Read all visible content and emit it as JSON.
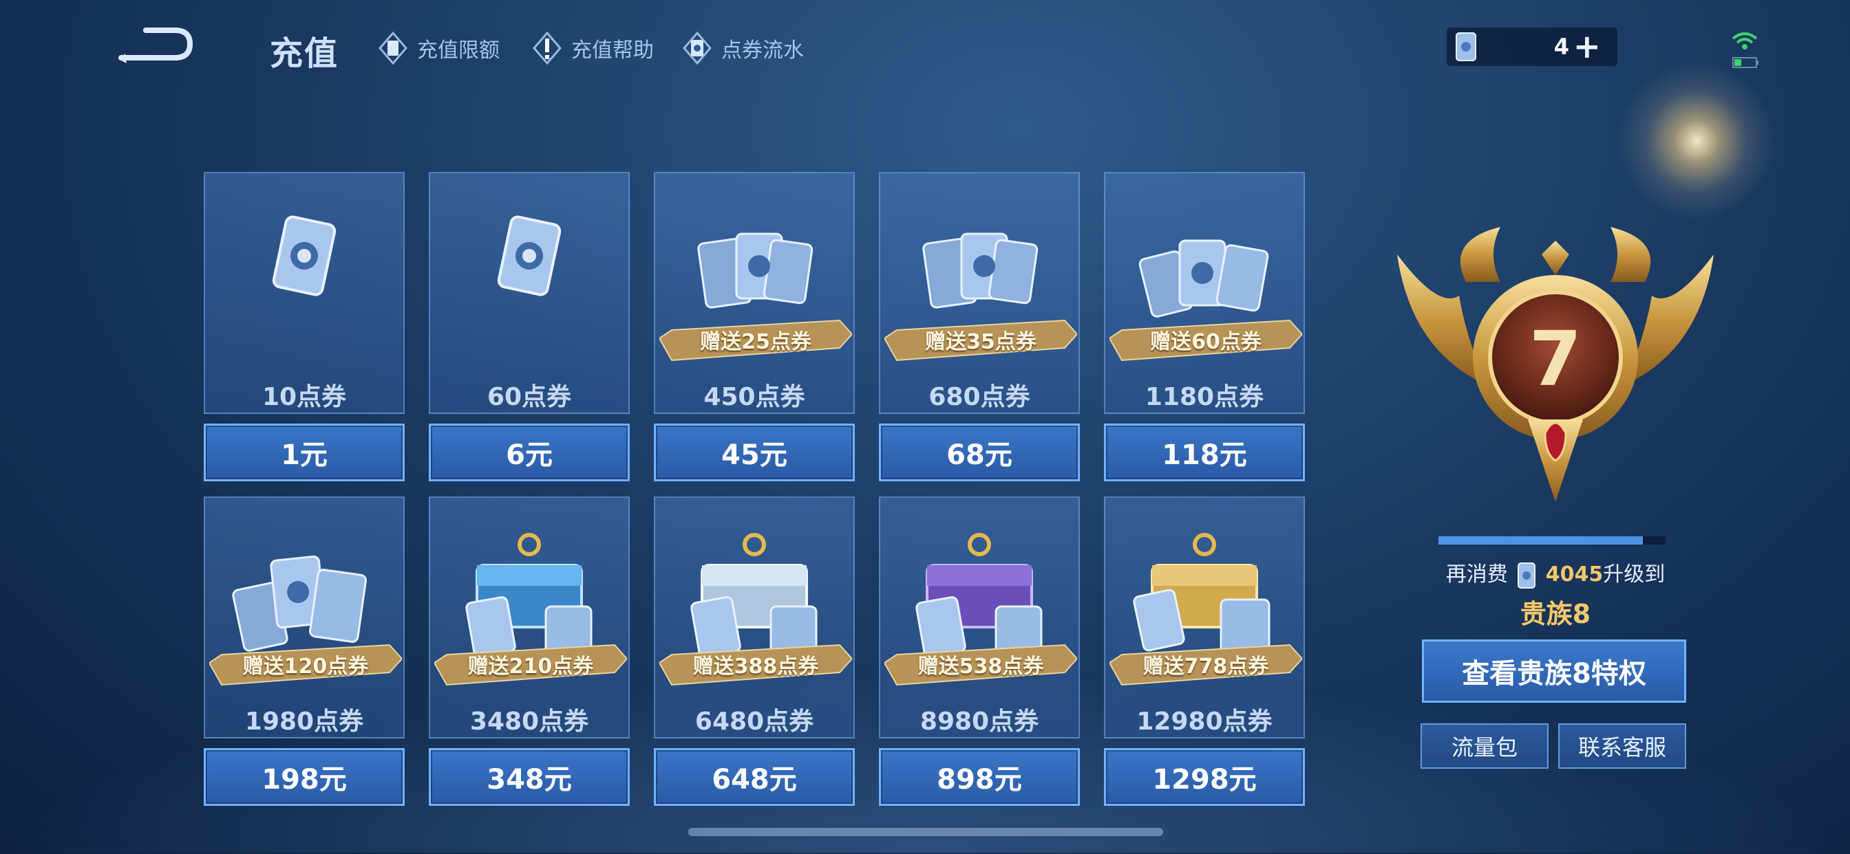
{
  "header": {
    "title": "充值",
    "links": [
      {
        "label": "充值限额",
        "icon": "card-icon"
      },
      {
        "label": "充值帮助",
        "icon": "exclamation-icon"
      },
      {
        "label": "点券流水",
        "icon": "voucher-icon"
      }
    ],
    "currency_amount": "4",
    "plus_label": "+"
  },
  "packages": [
    {
      "qty": "10点券",
      "price": "1元",
      "bonus": "",
      "art": "single-voucher"
    },
    {
      "qty": "60点券",
      "price": "6元",
      "bonus": "",
      "art": "single-voucher"
    },
    {
      "qty": "450点券",
      "price": "45元",
      "bonus": "赠送25点券",
      "art": "voucher-stack-small"
    },
    {
      "qty": "680点券",
      "price": "68元",
      "bonus": "赠送35点券",
      "art": "voucher-stack-small"
    },
    {
      "qty": "1180点券",
      "price": "118元",
      "bonus": "赠送60点券",
      "art": "voucher-stack-medium"
    },
    {
      "qty": "1980点券",
      "price": "198元",
      "bonus": "赠送120点券",
      "art": "voucher-stack-large"
    },
    {
      "qty": "3480点券",
      "price": "348元",
      "bonus": "赠送210点券",
      "art": "chest-blue"
    },
    {
      "qty": "6480点券",
      "price": "648元",
      "bonus": "赠送388点券",
      "art": "chest-silver"
    },
    {
      "qty": "8980点券",
      "price": "898元",
      "bonus": "赠送538点券",
      "art": "chest-purple"
    },
    {
      "qty": "12980点券",
      "price": "1298元",
      "bonus": "赠送778点券",
      "art": "chest-gold"
    }
  ],
  "noble": {
    "emblem_number": "7",
    "progress": 0.9,
    "upgrade_prefix": "再消费",
    "upgrade_amount": "4045",
    "upgrade_suffix": "升级到",
    "next_level": "贵族8",
    "view_button": "查看贵族8特权",
    "data_pack_button": "流量包",
    "support_button": "联系客服"
  },
  "colors": {
    "accent_blue": "#4f92e6",
    "gold": "#f4c86a",
    "ribbon": "#b89358"
  }
}
